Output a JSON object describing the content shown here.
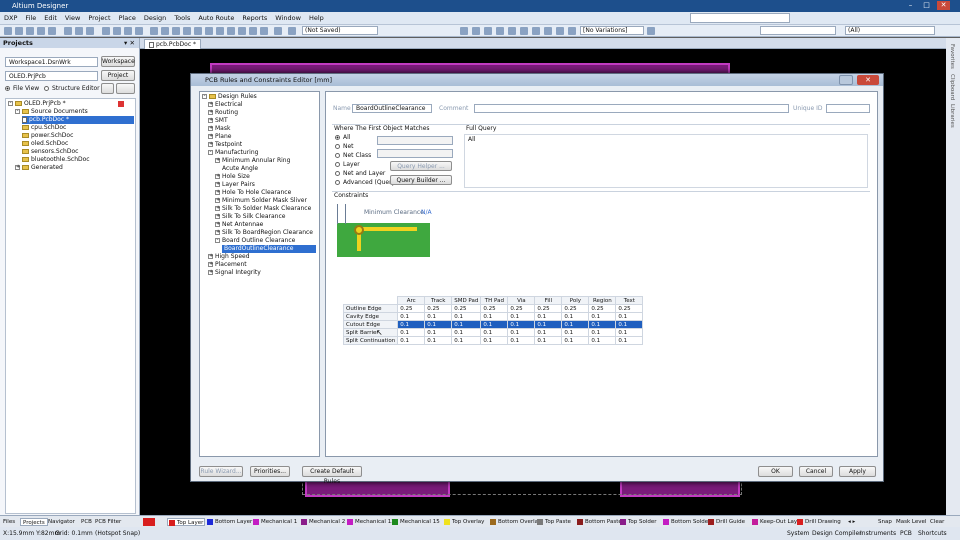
{
  "app": {
    "title": "Altium Designer"
  },
  "menu": [
    "DXP",
    "File",
    "Edit",
    "View",
    "Project",
    "Place",
    "Design",
    "Tools",
    "Auto Route",
    "Reports",
    "Window",
    "Help"
  ],
  "toolbar": {
    "not_saved": "(Not Saved)",
    "no_variations": "[No Variations]",
    "all": "(All)"
  },
  "projects_panel": {
    "title": "Projects",
    "workspace": "Workspace1.DsnWrk",
    "workspace_btn": "Workspace",
    "project": "OLED.PrjPcb",
    "project_btn": "Project",
    "file_view": "File View",
    "structure_editor": "Structure Editor",
    "tree": [
      {
        "label": "OLED.PrjPcb *",
        "level": 0,
        "kind": "project"
      },
      {
        "label": "Source Documents",
        "level": 1,
        "kind": "folder"
      },
      {
        "label": "pcb.PcbDoc *",
        "level": 2,
        "kind": "doc",
        "selected": true
      },
      {
        "label": "cpu.SchDoc",
        "level": 2,
        "kind": "doc"
      },
      {
        "label": "power.SchDoc",
        "level": 2,
        "kind": "doc"
      },
      {
        "label": "oled.SchDoc",
        "level": 2,
        "kind": "doc"
      },
      {
        "label": "sensors.SchDoc",
        "level": 2,
        "kind": "doc"
      },
      {
        "label": "bluetoothle.SchDoc",
        "level": 2,
        "kind": "doc"
      },
      {
        "label": "Generated",
        "level": 1,
        "kind": "folder"
      }
    ]
  },
  "doc_tab": "pcb.PcbDoc *",
  "dialog": {
    "title": "PCB Rules and Constraints Editor [mm]",
    "tree": [
      {
        "label": "Design Rules",
        "level": 0
      },
      {
        "label": "Electrical",
        "level": 1
      },
      {
        "label": "Routing",
        "level": 1
      },
      {
        "label": "SMT",
        "level": 1
      },
      {
        "label": "Mask",
        "level": 1
      },
      {
        "label": "Plane",
        "level": 1
      },
      {
        "label": "Testpoint",
        "level": 1
      },
      {
        "label": "Manufacturing",
        "level": 1
      },
      {
        "label": "Minimum Annular Ring",
        "level": 2
      },
      {
        "label": "Acute Angle",
        "level": 2
      },
      {
        "label": "Hole Size",
        "level": 2
      },
      {
        "label": "Layer Pairs",
        "level": 2
      },
      {
        "label": "Hole To Hole Clearance",
        "level": 2
      },
      {
        "label": "Minimum Solder Mask Sliver",
        "level": 2
      },
      {
        "label": "Silk To Solder Mask Clearance",
        "level": 2
      },
      {
        "label": "Silk To Silk Clearance",
        "level": 2
      },
      {
        "label": "Net Antennae",
        "level": 2
      },
      {
        "label": "Silk To BoardRegion Clearance",
        "level": 2
      },
      {
        "label": "Board Outline Clearance",
        "level": 2
      },
      {
        "label": "BoardOutlineClearance",
        "level": 3,
        "selected": true
      },
      {
        "label": "High Speed",
        "level": 1
      },
      {
        "label": "Placement",
        "level": 1
      },
      {
        "label": "Signal Integrity",
        "level": 1
      }
    ],
    "name_label": "Name",
    "name_value": "BoardOutlineClearance",
    "comment_label": "Comment",
    "unique_id_label": "Unique ID",
    "where_title": "Where The First Object Matches",
    "where_options": [
      "All",
      "Net",
      "Net Class",
      "Layer",
      "Net and Layer",
      "Advanced (Query)"
    ],
    "query_helper": "Query Helper ...",
    "query_builder": "Query Builder ...",
    "full_query_title": "Full Query",
    "full_query": "All",
    "constraints_title": "Constraints",
    "min_clearance_label": "Minimum Clearance",
    "min_clearance_value": "N/A",
    "table": {
      "columns": [
        "Arc",
        "Track",
        "SMD Pad",
        "TH Pad",
        "Via",
        "Fill",
        "Poly",
        "Region",
        "Text"
      ],
      "rows": [
        {
          "name": "Outline Edge",
          "values": [
            "0.25",
            "0.25",
            "0.25",
            "0.25",
            "0.25",
            "0.25",
            "0.25",
            "0.25",
            "0.25"
          ]
        },
        {
          "name": "Cavity Edge",
          "values": [
            "0.1",
            "0.1",
            "0.1",
            "0.1",
            "0.1",
            "0.1",
            "0.1",
            "0.1",
            "0.1"
          ]
        },
        {
          "name": "Cutout Edge",
          "values": [
            "0.1",
            "0.1",
            "0.1",
            "0.1",
            "0.1",
            "0.1",
            "0.1",
            "0.1",
            "0.1"
          ],
          "selected": true
        },
        {
          "name": "Split Barrier",
          "values": [
            "0.1",
            "0.1",
            "0.1",
            "0.1",
            "0.1",
            "0.1",
            "0.1",
            "0.1",
            "0.1"
          ]
        },
        {
          "name": "Split Continuation",
          "values": [
            "0.1",
            "0.1",
            "0.1",
            "0.1",
            "0.1",
            "0.1",
            "0.1",
            "0.1",
            "0.1"
          ]
        }
      ]
    },
    "buttons": {
      "rule_wizard": "Rule Wizard...",
      "priorities": "Priorities...",
      "create_default": "Create Default Rules",
      "ok": "OK",
      "cancel": "Cancel",
      "apply": "Apply"
    }
  },
  "panel_tabs": [
    "Files",
    "Projects",
    "Navigator",
    "PCB",
    "PCB Filter"
  ],
  "layers": [
    {
      "name": "Top Layer",
      "color": "#d81e1e"
    },
    {
      "name": "Bottom Layer",
      "color": "#1e2ad8"
    },
    {
      "name": "Mechanical 1",
      "color": "#c31dc3"
    },
    {
      "name": "Mechanical 2",
      "color": "#8a1d8a"
    },
    {
      "name": "Mechanical 13",
      "color": "#c31dc3"
    },
    {
      "name": "Mechanical 15",
      "color": "#1d8a1d"
    },
    {
      "name": "Top Overlay",
      "color": "#f0e21e"
    },
    {
      "name": "Bottom Overlay",
      "color": "#9c6a1d"
    },
    {
      "name": "Top Paste",
      "color": "#7a7a7a"
    },
    {
      "name": "Bottom Paste",
      "color": "#8a1d1d"
    },
    {
      "name": "Top Solder",
      "color": "#8a1d8a"
    },
    {
      "name": "Bottom Solder",
      "color": "#c31dc3"
    },
    {
      "name": "Drill Guide",
      "color": "#9c1d1d"
    },
    {
      "name": "Keep-Out Layer",
      "color": "#c31d9c"
    },
    {
      "name": "Drill Drawing",
      "color": "#d81e1e"
    }
  ],
  "snap_controls": {
    "snap": "Snap",
    "mask_level": "Mask Level",
    "clear": "Clear"
  },
  "status": {
    "coords": "X:15.9mm Y:82mm",
    "grid": "Grid: 0.1mm",
    "snap": "(Hotspot Snap)",
    "right": [
      "System",
      "Design Compiler",
      "Instruments",
      "PCB",
      "Shortcuts"
    ]
  },
  "right_strip": [
    "Favorites",
    "Clipboard",
    "Libraries"
  ]
}
